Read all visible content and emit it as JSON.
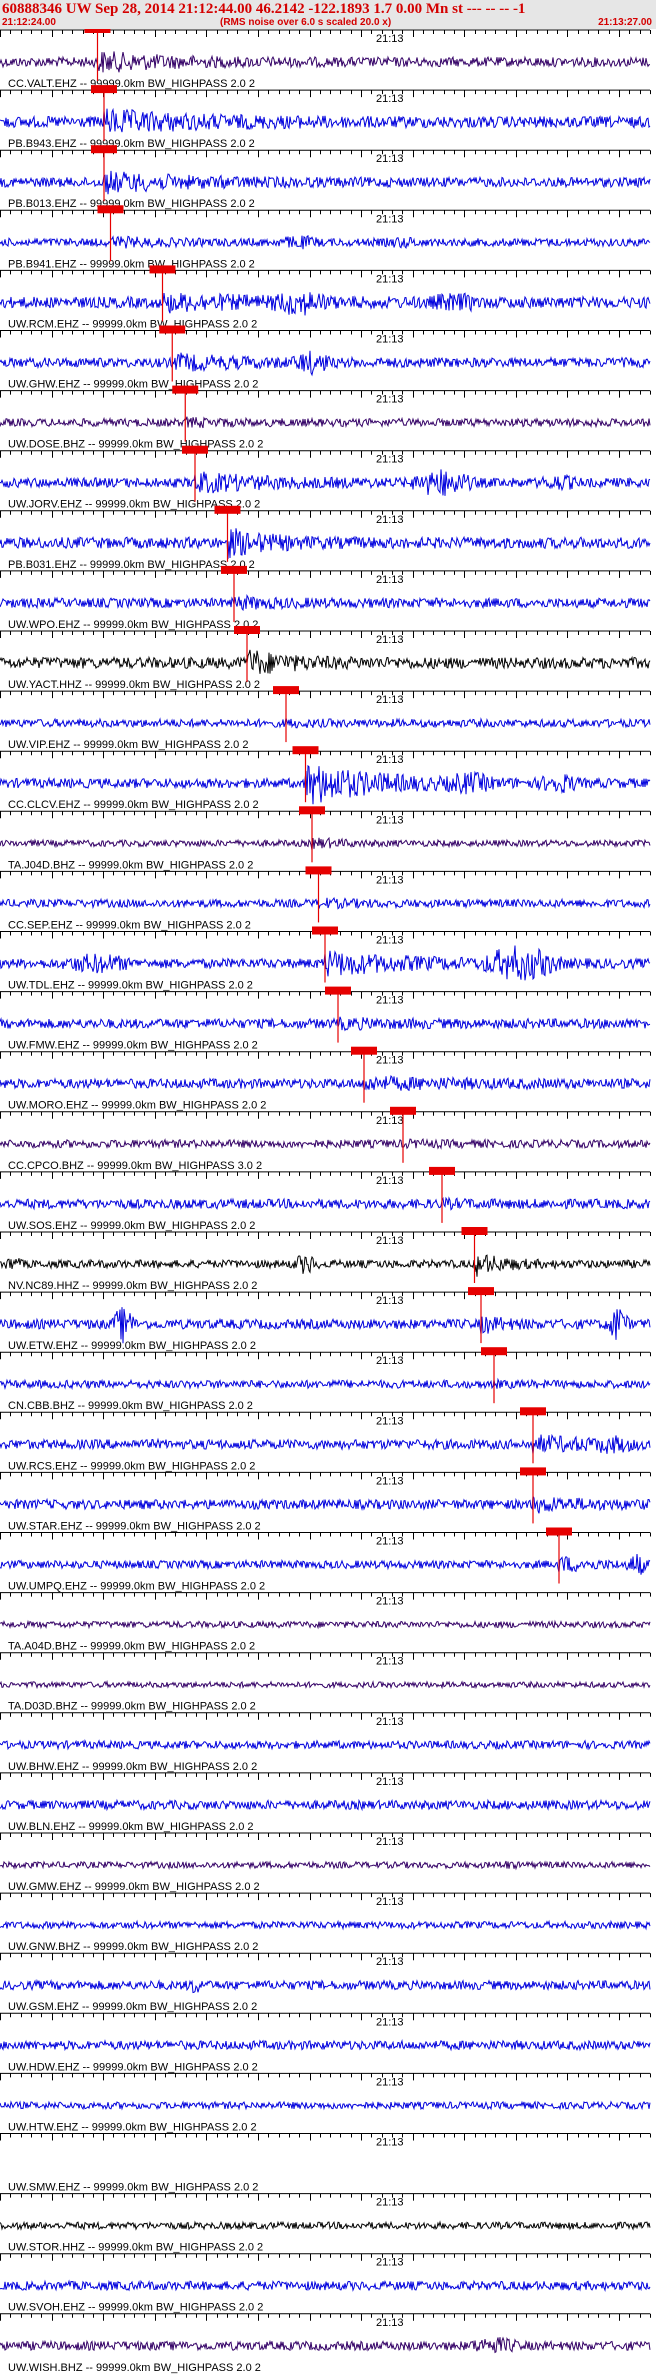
{
  "header": {
    "title": "60888346 UW Sep 28, 2014 21:12:44.00   46.2142 -122.1893  1.7 0.00 Mn st --- -- --  -1",
    "start_time": "21:12:24.00",
    "note": "(RMS noise over 6.0 s scaled 20.0 x)",
    "end_time": "21:13:27.00"
  },
  "time_marker_label": "21:13",
  "pick_color": "#e60000",
  "traces": [
    {
      "label": "CC.VALT.EHZ -- 99999.0km BW_HIGHPASS  2.0  2",
      "color": "#330066",
      "amp": 0.3,
      "pick": 0.15,
      "dur": 0.1,
      "burst": 2.6,
      "bursts": []
    },
    {
      "label": "PB.B943.EHZ -- 99999.0km BW_HIGHPASS  2.0  2",
      "color": "#0000dd",
      "amp": 0.35,
      "pick": 0.16,
      "dur": 0.14,
      "burst": 2.6,
      "bursts": []
    },
    {
      "label": "PB.B013.EHZ -- 99999.0km BW_HIGHPASS  2.0  2",
      "color": "#0000dd",
      "amp": 0.3,
      "pick": 0.16,
      "dur": 0.12,
      "burst": 2.6,
      "bursts": []
    },
    {
      "label": "PB.B941.EHZ -- 99999.0km BW_HIGHPASS  2.0  2",
      "color": "#0000dd",
      "amp": 0.25,
      "pick": 0.17,
      "dur": 0.06,
      "burst": 1.8,
      "bursts": [
        [
          0.46,
          0.7,
          1.8
        ],
        [
          0.62,
          0.7,
          1.5
        ]
      ]
    },
    {
      "label": "UW.RCM.EHZ -- 99999.0km BW_HIGHPASS  2.0  2",
      "color": "#0000dd",
      "amp": 0.35,
      "pick": 0.25,
      "dur": 0.15,
      "burst": 2.0,
      "bursts": [
        [
          0.46,
          0.9,
          2.4
        ],
        [
          0.7,
          0.9,
          1.8
        ]
      ]
    },
    {
      "label": "UW.GHW.EHZ -- 99999.0km BW_HIGHPASS  2.0  2",
      "color": "#0000dd",
      "amp": 0.3,
      "pick": 0.265,
      "dur": 0.1,
      "burst": 2.2,
      "bursts": [
        [
          0.48,
          0.5,
          2.6
        ]
      ]
    },
    {
      "label": "UW.DOSE.BHZ -- 99999.0km BW_HIGHPASS  2.0  2",
      "color": "#330066",
      "amp": 0.25,
      "pick": 0.285,
      "dur": 0.05,
      "burst": 1.6,
      "bursts": []
    },
    {
      "label": "UW.JORV.EHZ -- 99999.0km BW_HIGHPASS  2.0  2",
      "color": "#0000dd",
      "amp": 0.3,
      "pick": 0.3,
      "dur": 0.1,
      "burst": 2.6,
      "bursts": [
        [
          0.68,
          0.8,
          3.0
        ],
        [
          0.86,
          0.6,
          1.8
        ]
      ]
    },
    {
      "label": "PB.B031.EHZ -- 99999.0km BW_HIGHPASS  2.0  2",
      "color": "#0000dd",
      "amp": 0.35,
      "pick": 0.35,
      "dur": 0.06,
      "burst": 3.0,
      "bursts": [
        [
          0.4,
          0.6,
          1.5
        ]
      ]
    },
    {
      "label": "UW.WPO.EHZ -- 99999.0km BW_HIGHPASS  2.0  2",
      "color": "#0000dd",
      "amp": 0.3,
      "pick": 0.36,
      "dur": 0.06,
      "burst": 1.8,
      "bursts": []
    },
    {
      "label": "UW.YACT.HHZ -- 99999.0km BW_HIGHPASS  2.0  2",
      "color": "#000000",
      "amp": 0.35,
      "pick": 0.38,
      "dur": 0.06,
      "burst": 2.8,
      "bursts": []
    },
    {
      "label": "UW.VIP.EHZ -- 99999.0km BW_HIGHPASS  2.0  2",
      "color": "#0000dd",
      "amp": 0.25,
      "pick": 0.44,
      "dur": 0.05,
      "burst": 1.4,
      "bursts": []
    },
    {
      "label": "CC.CLCV.EHZ -- 99999.0km BW_HIGHPASS  2.0  2",
      "color": "#0000dd",
      "amp": 0.3,
      "pick": 0.47,
      "dur": 0.1,
      "burst": 5.0,
      "bursts": [
        [
          0.72,
          0.8,
          2.4
        ],
        [
          0.86,
          0.6,
          2.2
        ]
      ]
    },
    {
      "label": "TA.J04D.BHZ -- 99999.0km BW_HIGHPASS  2.0  2",
      "color": "#330066",
      "amp": 0.2,
      "pick": 0.48,
      "dur": 0.04,
      "burst": 2.2,
      "bursts": []
    },
    {
      "label": "CC.SEP.EHZ -- 99999.0km BW_HIGHPASS  2.0  2",
      "color": "#0000dd",
      "amp": 0.25,
      "pick": 0.49,
      "dur": 0.05,
      "burst": 1.6,
      "bursts": []
    },
    {
      "label": "UW.TDL.EHZ -- 99999.0km BW_HIGHPASS  2.0  2",
      "color": "#0000dd",
      "amp": 0.3,
      "pick": 0.5,
      "dur": 0.12,
      "burst": 3.0,
      "bursts": [
        [
          0.15,
          1.0,
          2.2
        ],
        [
          0.8,
          1.0,
          3.8
        ]
      ]
    },
    {
      "label": "UW.FMW.EHZ -- 99999.0km BW_HIGHPASS  2.0  2",
      "color": "#0000dd",
      "amp": 0.3,
      "pick": 0.52,
      "dur": 0.08,
      "burst": 1.5,
      "bursts": []
    },
    {
      "label": "UW.MORO.EHZ -- 99999.0km BW_HIGHPASS  2.0  2",
      "color": "#0000dd",
      "amp": 0.3,
      "pick": 0.56,
      "dur": 0.14,
      "burst": 1.8,
      "bursts": []
    },
    {
      "label": "CC.CPCO.BHZ -- 99999.0km BW_HIGHPASS  3.0  2",
      "color": "#330066",
      "amp": 0.25,
      "pick": 0.62,
      "dur": 0.05,
      "burst": 1.3,
      "bursts": []
    },
    {
      "label": "UW.SOS.EHZ -- 99999.0km BW_HIGHPASS  2.0  2",
      "color": "#0000dd",
      "amp": 0.3,
      "pick": 0.68,
      "dur": 0.05,
      "burst": 1.3,
      "bursts": []
    },
    {
      "label": "NV.NC89.HHZ -- 99999.0km BW_HIGHPASS  2.0  2",
      "color": "#000000",
      "amp": 0.25,
      "pick": 0.73,
      "dur": 0.04,
      "burst": 3.4,
      "bursts": [
        [
          0.47,
          0.3,
          2.6
        ],
        [
          0.02,
          0.2,
          2.0
        ]
      ]
    },
    {
      "label": "UW.ETW.EHZ -- 99999.0km BW_HIGHPASS  2.0  2",
      "color": "#0000dd",
      "amp": 0.3,
      "pick": 0.74,
      "dur": 0.03,
      "burst": 2.4,
      "bursts": [
        [
          0.19,
          0.2,
          4.0
        ],
        [
          0.95,
          0.2,
          4.0
        ]
      ]
    },
    {
      "label": "CN.CBB.BHZ -- 99999.0km BW_HIGHPASS  2.0  2",
      "color": "#0000dd",
      "amp": 0.25,
      "pick": 0.76,
      "dur": 0.04,
      "burst": 1.2,
      "bursts": []
    },
    {
      "label": "UW.RCS.EHZ -- 99999.0km BW_HIGHPASS  2.0  2",
      "color": "#0000dd",
      "amp": 0.3,
      "pick": 0.82,
      "dur": 0.1,
      "burst": 2.2,
      "bursts": [
        [
          0.94,
          0.8,
          2.0
        ]
      ]
    },
    {
      "label": "UW.STAR.EHZ -- 99999.0km BW_HIGHPASS  2.0  2",
      "color": "#0000dd",
      "amp": 0.3,
      "pick": 0.82,
      "dur": 0.08,
      "burst": 2.0,
      "bursts": []
    },
    {
      "label": "UW.UMPQ.EHZ -- 99999.0km BW_HIGHPASS  2.0  2",
      "color": "#0000dd",
      "amp": 0.25,
      "pick": 0.86,
      "dur": 0.04,
      "burst": 2.6,
      "bursts": [
        [
          0.98,
          0.2,
          3.0
        ]
      ]
    },
    {
      "label": "TA.A04D.BHZ -- 99999.0km BW_HIGHPASS  2.0  2",
      "color": "#330066",
      "amp": 0.2,
      "pick": null,
      "dur": 0,
      "burst": 1,
      "bursts": []
    },
    {
      "label": "TA.D03D.BHZ -- 99999.0km BW_HIGHPASS  2.0  2",
      "color": "#330066",
      "amp": 0.18,
      "pick": null,
      "dur": 0,
      "burst": 1,
      "bursts": []
    },
    {
      "label": "UW.BHW.EHZ -- 99999.0km BW_HIGHPASS  2.0  2",
      "color": "#0000dd",
      "amp": 0.25,
      "pick": null,
      "dur": 0,
      "burst": 1,
      "bursts": []
    },
    {
      "label": "UW.BLN.EHZ -- 99999.0km BW_HIGHPASS  2.0  2",
      "color": "#0000dd",
      "amp": 0.28,
      "pick": null,
      "dur": 0,
      "burst": 1,
      "bursts": []
    },
    {
      "label": "UW.GMW.EHZ -- 99999.0km BW_HIGHPASS  2.0  2",
      "color": "#330066",
      "amp": 0.2,
      "pick": null,
      "dur": 0,
      "burst": 1,
      "bursts": [
        [
          0.78,
          0.4,
          1.5
        ]
      ]
    },
    {
      "label": "UW.GNW.BHZ -- 99999.0km BW_HIGHPASS  2.0  2",
      "color": "#0000dd",
      "amp": 0.22,
      "pick": null,
      "dur": 0,
      "burst": 1,
      "bursts": []
    },
    {
      "label": "UW.GSM.EHZ -- 99999.0km BW_HIGHPASS  2.0  2",
      "color": "#0000dd",
      "amp": 0.28,
      "pick": null,
      "dur": 0,
      "burst": 1,
      "bursts": [
        [
          0.3,
          0.2,
          2.0
        ]
      ]
    },
    {
      "label": "UW.HDW.EHZ -- 99999.0km BW_HIGHPASS  2.0  2",
      "color": "#0000dd",
      "amp": 0.28,
      "pick": null,
      "dur": 0,
      "burst": 1,
      "bursts": []
    },
    {
      "label": "UW.HTW.EHZ -- 99999.0km BW_HIGHPASS  2.0  2",
      "color": "#0000dd",
      "amp": 0.22,
      "pick": null,
      "dur": 0,
      "burst": 1,
      "bursts": []
    },
    {
      "label": "UW.SMW.EHZ -- 99999.0km BW_HIGHPASS  2.0  2",
      "color": "#ffffff",
      "amp": 0.0,
      "pick": null,
      "dur": 0,
      "burst": 1,
      "bursts": []
    },
    {
      "label": "UW.STOR.HHZ -- 99999.0km BW_HIGHPASS  2.0  2",
      "color": "#000000",
      "amp": 0.22,
      "pick": null,
      "dur": 0,
      "burst": 1,
      "bursts": []
    },
    {
      "label": "UW.SVOH.EHZ -- 99999.0km BW_HIGHPASS  2.0  2",
      "color": "#0000dd",
      "amp": 0.28,
      "pick": null,
      "dur": 0,
      "burst": 1,
      "bursts": []
    },
    {
      "label": "UW.WISH.BHZ -- 99999.0km BW_HIGHPASS  2.0  2",
      "color": "#330066",
      "amp": 0.28,
      "pick": null,
      "dur": 0,
      "burst": 1,
      "bursts": [
        [
          0.76,
          0.8,
          2.0
        ]
      ]
    }
  ]
}
